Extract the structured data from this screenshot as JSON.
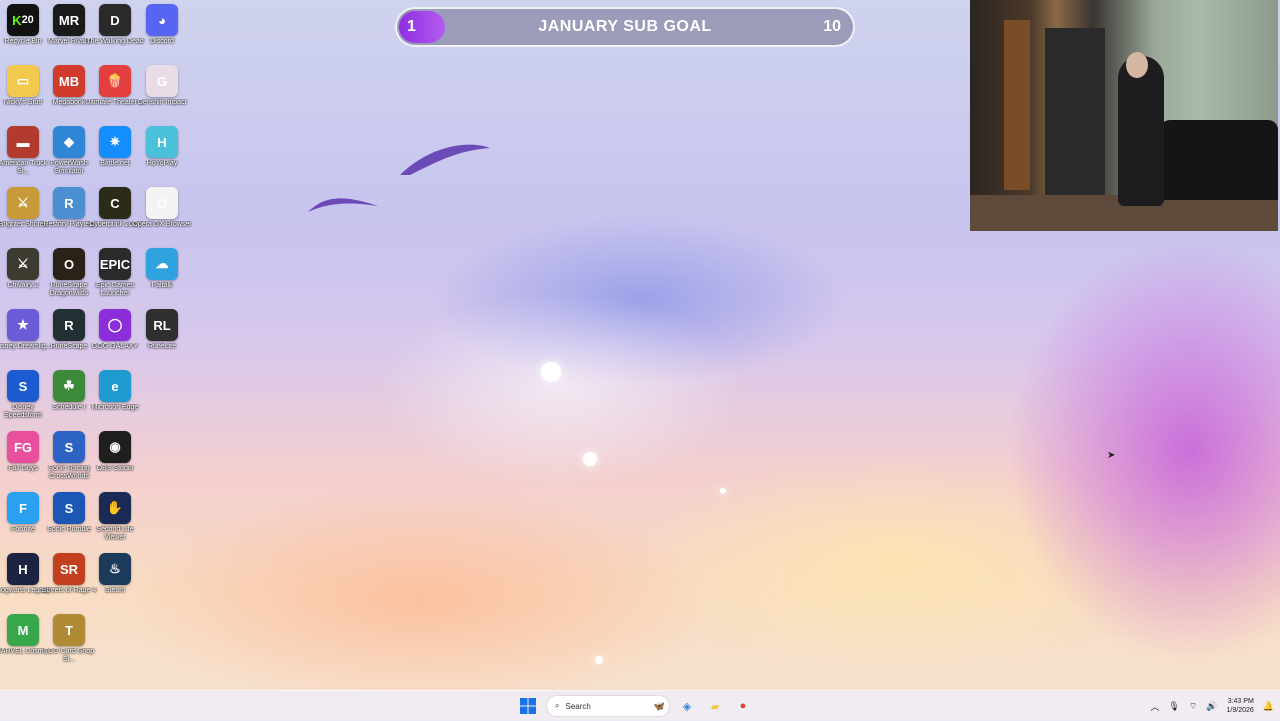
{
  "desktop_icons": [
    {
      "label": "Recycle Bin",
      "glyph": "K",
      "badge": "20",
      "color": "#111111",
      "icon": "kick-20-icon"
    },
    {
      "label": "Nicky's Stuff",
      "glyph": "▭",
      "color": "#f2c94c",
      "icon": "folder-icon"
    },
    {
      "label": "American Truck Si...",
      "glyph": "▬",
      "color": "#b33b2e",
      "icon": "truck-icon"
    },
    {
      "label": "Brighter Shores",
      "glyph": "⚔",
      "color": "#c99a3a",
      "icon": "brighter-shores-icon"
    },
    {
      "label": "Chivalry 2",
      "glyph": "⚔",
      "color": "#3d3a30",
      "icon": "chivalry-icon"
    },
    {
      "label": "Disney Dreamlig...",
      "glyph": "★",
      "color": "#6a5bd6",
      "icon": "disney-dreamlight-icon"
    },
    {
      "label": "Disney Speedstorm",
      "glyph": "S",
      "color": "#1d5bd1",
      "icon": "speedstorm-icon"
    },
    {
      "label": "Fall Guys",
      "glyph": "FG",
      "color": "#e8509d",
      "icon": "fall-guys-icon"
    },
    {
      "label": "Fortnite",
      "glyph": "F",
      "color": "#2aa1f0",
      "icon": "fortnite-icon"
    },
    {
      "label": "Hogwarts Legacy",
      "glyph": "H",
      "color": "#1c2442",
      "icon": "hogwarts-icon"
    },
    {
      "label": "MARVEL Cosmi...",
      "glyph": "M",
      "color": "#37a84a",
      "icon": "marvel-cosmic-icon"
    },
    {
      "label": "Marvel Rivals",
      "glyph": "MR",
      "color": "#1a1a1a",
      "icon": "marvel-rivals-icon"
    },
    {
      "label": "Megabonk",
      "glyph": "MB",
      "color": "#d13b2b",
      "icon": "megabonk-icon"
    },
    {
      "label": "PowerWash Simulator",
      "glyph": "◆",
      "color": "#2f86d6",
      "icon": "powerwash-icon"
    },
    {
      "label": "Restory Playtest",
      "glyph": "R",
      "color": "#4c8fd0",
      "icon": "restory-icon"
    },
    {
      "label": "RuneScape Dragonwilds",
      "glyph": "O",
      "color": "#2a2216",
      "icon": "dragonwilds-icon"
    },
    {
      "label": "RuneScape",
      "glyph": "R",
      "color": "#223033",
      "icon": "runescape-icon"
    },
    {
      "label": "Schedule I",
      "glyph": "☘",
      "color": "#3d8a3a",
      "icon": "schedule-icon"
    },
    {
      "label": "Sonic Racing CrossWorlds",
      "glyph": "S",
      "color": "#2c63c4",
      "icon": "sonic-racing-icon"
    },
    {
      "label": "Sonic Rumble",
      "glyph": "S",
      "color": "#1c57b5",
      "icon": "sonic-rumble-icon"
    },
    {
      "label": "Streets of Rage 4",
      "glyph": "SR",
      "color": "#c2401f",
      "icon": "streets-of-rage-icon"
    },
    {
      "label": "TCG Card Shop Si...",
      "glyph": "T",
      "color": "#b08a35",
      "icon": "tcg-card-shop-icon"
    },
    {
      "label": "The Walking Dead",
      "glyph": "D",
      "color": "#2a2a2a",
      "icon": "walking-dead-icon"
    },
    {
      "label": "Ultimate Theater ...",
      "glyph": "🍿",
      "color": "#e33f3f",
      "icon": "popcorn-icon"
    },
    {
      "label": "Battle.net",
      "glyph": "✷",
      "color": "#148eff",
      "icon": "battlenet-icon"
    },
    {
      "label": "Cyberpunk 2077",
      "glyph": "C",
      "color": "#2b2b18",
      "icon": "cyberpunk-icon"
    },
    {
      "label": "Epic Games Launcher",
      "glyph": "EPIC",
      "color": "#2a2a2a",
      "icon": "epic-games-icon"
    },
    {
      "label": "GOG GALAXY",
      "glyph": "◯",
      "color": "#8b2dd8",
      "icon": "gog-galaxy-icon"
    },
    {
      "label": "Microsoft Edge",
      "glyph": "e",
      "color": "#1d9bd1",
      "icon": "edge-icon"
    },
    {
      "label": "OBS Studio",
      "glyph": "◉",
      "color": "#1f1f1f",
      "icon": "obs-icon"
    },
    {
      "label": "Second Life Viewer",
      "glyph": "✋",
      "color": "#1a2a55",
      "icon": "second-life-icon"
    },
    {
      "label": "Steam",
      "glyph": "♨",
      "color": "#1b3a5c",
      "icon": "steam-icon"
    },
    {
      "label": "Discord",
      "glyph": "◕",
      "color": "#5865f2",
      "icon": "discord-icon"
    },
    {
      "label": "Genshin Impact",
      "glyph": "G",
      "color": "#e8dce6",
      "icon": "genshin-icon"
    },
    {
      "label": "HoYoPlay",
      "glyph": "H",
      "color": "#4bc0d9",
      "icon": "hoyoplay-icon"
    },
    {
      "label": "Opera GX Browser",
      "glyph": "O",
      "color": "#f3f3f3",
      "icon": "opera-gx-icon"
    },
    {
      "label": "Paltalk",
      "glyph": "☁",
      "color": "#2fa2e0",
      "icon": "paltalk-icon"
    },
    {
      "label": "RuneLite",
      "glyph": "RL",
      "color": "#2f2f2f",
      "icon": "runelite-icon"
    }
  ],
  "sub_goal": {
    "current": "1",
    "title": "JANUARY SUB GOAL",
    "target": "10",
    "progress": 0.1
  },
  "taskbar": {
    "search_placeholder": "Search",
    "apps": [
      {
        "icon": "copilot-icon",
        "glyph": "◈",
        "color": "#3a7bd5"
      },
      {
        "icon": "file-explorer-icon",
        "glyph": "▰",
        "color": "#f2c94c"
      },
      {
        "icon": "chrome-icon",
        "glyph": "●",
        "color": "#db4437"
      }
    ],
    "time": "3:43 PM",
    "date": "1/9/2026"
  },
  "colors": {
    "accent": "#9b3de6",
    "windows_blue": "#1a73e8"
  }
}
